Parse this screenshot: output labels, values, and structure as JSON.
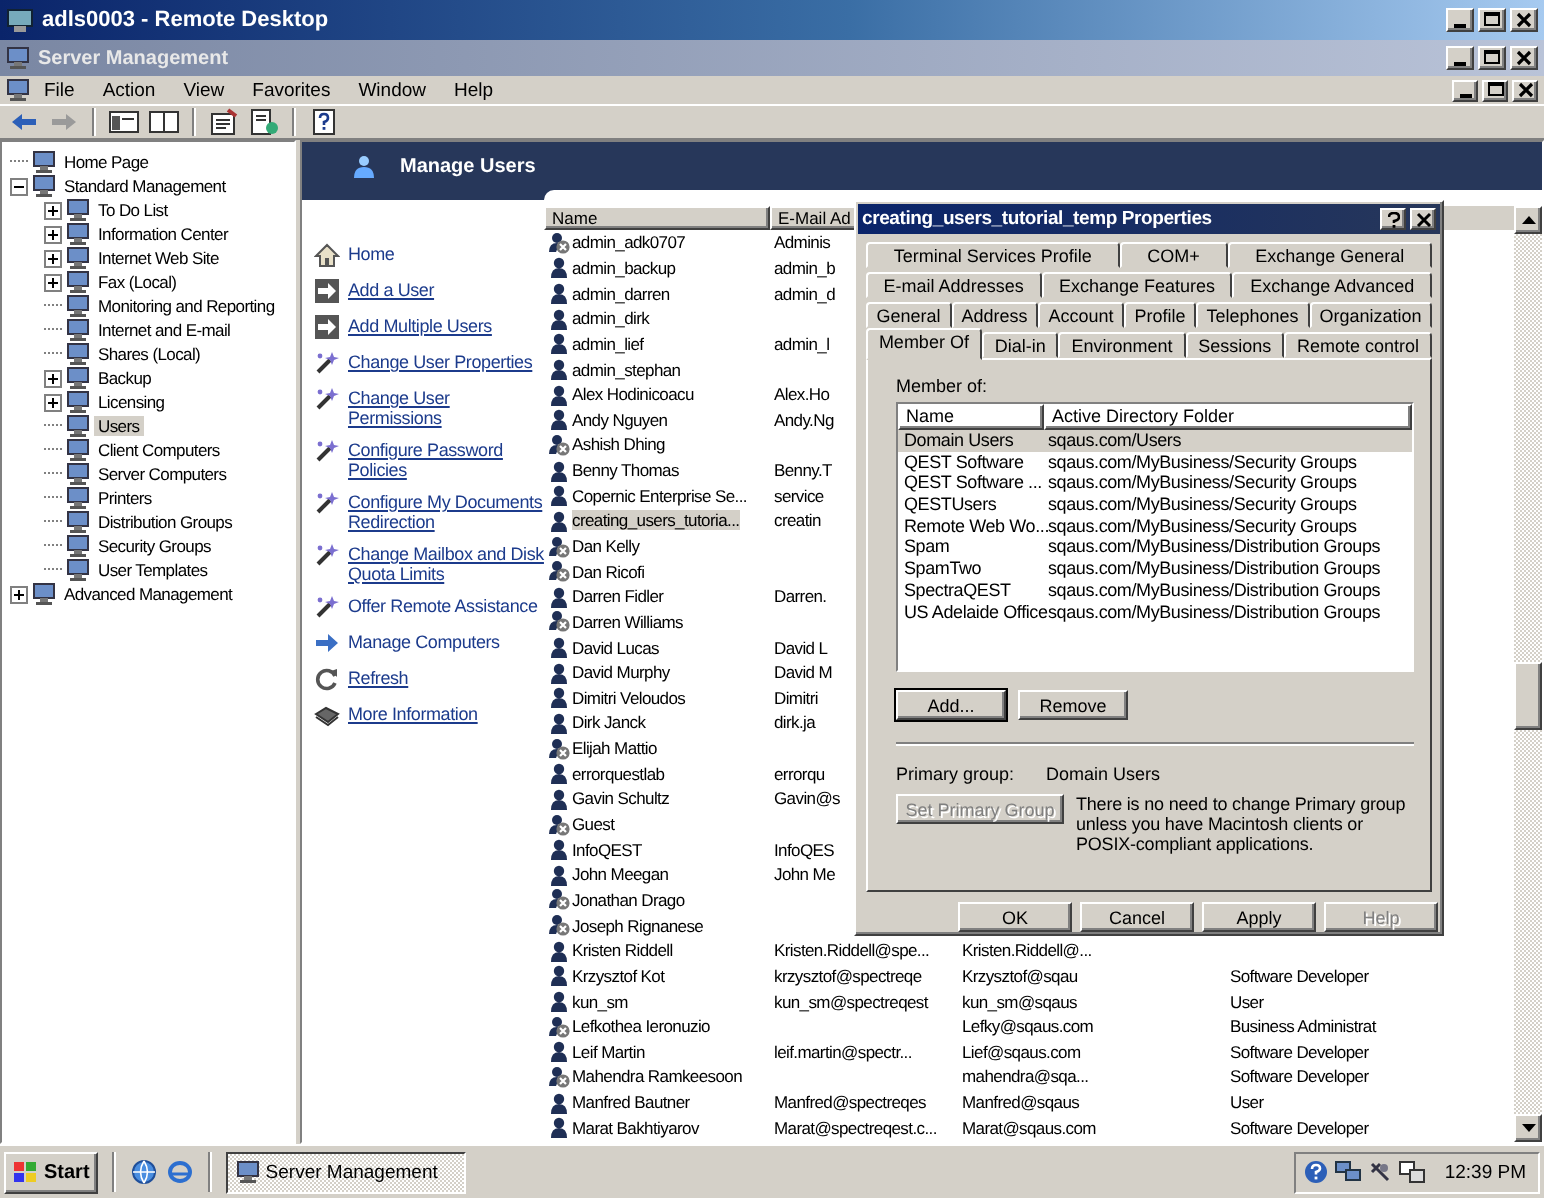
{
  "remote_window": {
    "title": "adls0003 - Remote Desktop"
  },
  "app_window": {
    "title": "Server Management"
  },
  "menu": [
    "File",
    "Action",
    "View",
    "Favorites",
    "Window",
    "Help"
  ],
  "tree": [
    {
      "label": "Home Page",
      "kind": "leaf",
      "expanded": false,
      "selected": false
    },
    {
      "label": "Standard Management",
      "kind": "branch",
      "expanded": true,
      "selected": false,
      "children": [
        {
          "label": "To Do List",
          "kind": "branch",
          "expanded": false,
          "selected": false
        },
        {
          "label": "Information Center",
          "kind": "branch",
          "expanded": false,
          "selected": false
        },
        {
          "label": "Internet Web Site",
          "kind": "branch",
          "expanded": false,
          "selected": false
        },
        {
          "label": "Fax (Local)",
          "kind": "branch",
          "expanded": false,
          "selected": false
        },
        {
          "label": "Monitoring and Reporting",
          "kind": "leaf",
          "expanded": false,
          "selected": false
        },
        {
          "label": "Internet and E-mail",
          "kind": "leaf",
          "expanded": false,
          "selected": false
        },
        {
          "label": "Shares (Local)",
          "kind": "leaf",
          "expanded": false,
          "selected": false
        },
        {
          "label": "Backup",
          "kind": "branch",
          "expanded": false,
          "selected": false
        },
        {
          "label": "Licensing",
          "kind": "branch",
          "expanded": false,
          "selected": false
        },
        {
          "label": "Users",
          "kind": "leaf",
          "expanded": false,
          "selected": true
        },
        {
          "label": "Client Computers",
          "kind": "leaf",
          "expanded": false,
          "selected": false
        },
        {
          "label": "Server Computers",
          "kind": "leaf",
          "expanded": false,
          "selected": false
        },
        {
          "label": "Printers",
          "kind": "leaf",
          "expanded": false,
          "selected": false
        },
        {
          "label": "Distribution Groups",
          "kind": "leaf",
          "expanded": false,
          "selected": false
        },
        {
          "label": "Security Groups",
          "kind": "leaf",
          "expanded": false,
          "selected": false
        },
        {
          "label": "User Templates",
          "kind": "leaf",
          "expanded": false,
          "selected": false
        }
      ]
    },
    {
      "label": "Advanced Management",
      "kind": "branch",
      "expanded": false,
      "selected": false
    }
  ],
  "panel": {
    "title": "Manage Users"
  },
  "tasks": [
    {
      "label": "Home",
      "kind": "home",
      "underlined": false
    },
    {
      "label": "Add a User",
      "kind": "add",
      "underlined": true
    },
    {
      "label": "Add Multiple Users",
      "kind": "add",
      "underlined": true
    },
    {
      "label": "Change User Properties",
      "kind": "wizard",
      "underlined": true
    },
    {
      "label": "Change User Permissions",
      "kind": "wizard",
      "underlined": true
    },
    {
      "label": "Configure Password Policies",
      "kind": "wizard",
      "underlined": true
    },
    {
      "label": "Configure My Documents Redirection",
      "kind": "wizard",
      "underlined": true
    },
    {
      "label": "Change Mailbox and Disk Quota Limits",
      "kind": "wizard",
      "underlined": true
    },
    {
      "label": "Offer Remote Assistance",
      "kind": "wizard",
      "underlined": false
    },
    {
      "label": "Manage Computers",
      "kind": "navigate",
      "underlined": false
    },
    {
      "label": "Refresh",
      "kind": "refresh",
      "underlined": true
    },
    {
      "label": "More Information",
      "kind": "info",
      "underlined": true
    }
  ],
  "user_list": {
    "columns": [
      "Name",
      "E-Mail Ad"
    ],
    "rows": [
      {
        "name": "admin_adk0707",
        "kind": "disabled",
        "selected": false,
        "email": "Adminis"
      },
      {
        "name": "admin_backup",
        "kind": "user",
        "selected": false,
        "email": "admin_b"
      },
      {
        "name": "admin_darren",
        "kind": "user",
        "selected": false,
        "email": "admin_d"
      },
      {
        "name": "admin_dirk",
        "kind": "user",
        "selected": false
      },
      {
        "name": "admin_lief",
        "kind": "user",
        "selected": false,
        "email": "admin_l"
      },
      {
        "name": "admin_stephan",
        "kind": "user",
        "selected": false
      },
      {
        "name": "Alex Hodinicoacu",
        "kind": "user",
        "selected": false,
        "email": "Alex.Ho"
      },
      {
        "name": "Andy Nguyen",
        "kind": "user",
        "selected": false,
        "email": "Andy.Ng"
      },
      {
        "name": "Ashish Dhing",
        "kind": "disabled",
        "selected": false
      },
      {
        "name": "Benny Thomas",
        "kind": "user",
        "selected": false,
        "email": "Benny.T"
      },
      {
        "name": "Copernic Enterprise Se...",
        "kind": "user",
        "selected": false,
        "email": "service"
      },
      {
        "name": "creating_users_tutoria...",
        "kind": "user",
        "selected": true,
        "email": "creatin"
      },
      {
        "name": "Dan Kelly",
        "kind": "disabled",
        "selected": false
      },
      {
        "name": "Dan Ricofi",
        "kind": "disabled",
        "selected": false
      },
      {
        "name": "Darren Fidler",
        "kind": "user",
        "selected": false,
        "email": "Darren."
      },
      {
        "name": "Darren Williams",
        "kind": "disabled",
        "selected": false
      },
      {
        "name": "David Lucas",
        "kind": "user",
        "selected": false,
        "email": "David L"
      },
      {
        "name": "David Murphy",
        "kind": "user",
        "selected": false,
        "email": "David M"
      },
      {
        "name": "Dimitri Veloudos",
        "kind": "user",
        "selected": false,
        "email": "Dimitri"
      },
      {
        "name": "Dirk Janck",
        "kind": "user",
        "selected": false,
        "email": "dirk.ja"
      },
      {
        "name": "Elijah Mattio",
        "kind": "disabled",
        "selected": false
      },
      {
        "name": "errorquestlab",
        "kind": "user",
        "selected": false,
        "email": "errorqu"
      },
      {
        "name": "Gavin Schultz",
        "kind": "user",
        "selected": false,
        "email": "Gavin@s"
      },
      {
        "name": "Guest",
        "kind": "disabled",
        "selected": false
      },
      {
        "name": "InfoQEST",
        "kind": "user",
        "selected": false,
        "email": "InfoQES"
      },
      {
        "name": "John Meegan",
        "kind": "user",
        "selected": false,
        "email": "John Me"
      },
      {
        "name": "Jonathan Drago",
        "kind": "disabled",
        "selected": false
      },
      {
        "name": "Joseph Rignanese",
        "kind": "disabled",
        "selected": false
      },
      {
        "name": "Kristen Riddell",
        "kind": "user",
        "selected": false,
        "email": "Kristen.Riddell@spe...",
        "column_3": "Kristen.Riddell@..."
      },
      {
        "name": "Krzysztof Kot",
        "kind": "user",
        "selected": false,
        "email": "krzysztof@spectreqe",
        "column_3": "Krzysztof@sqau",
        "column_4": "Software Developer"
      },
      {
        "name": "kun_sm",
        "kind": "user",
        "selected": false,
        "email": "kun_sm@spectreqest",
        "column_3": "kun_sm@sqaus",
        "column_4": "User"
      },
      {
        "name": "Lefkothea Ieronuzio",
        "kind": "disabled",
        "selected": false,
        "column_3": "Lefky@sqaus.com",
        "column_4": "Business Administrat"
      },
      {
        "name": "Leif Martin",
        "kind": "user",
        "selected": false,
        "email": "leif.martin@spectr...",
        "column_3": "Lief@sqaus.com",
        "column_4": "Software Developer"
      },
      {
        "name": "Mahendra Ramkeesoon",
        "kind": "disabled",
        "selected": false,
        "column_3": "mahendra@sqa...",
        "column_4": "Software Developer"
      },
      {
        "name": "Manfred Bautner",
        "kind": "user",
        "selected": false,
        "email": "Manfred@spectreqes",
        "column_3": "Manfred@sqaus",
        "column_4": "User"
      },
      {
        "name": "Marat Bakhtiyarov",
        "kind": "user",
        "selected": false,
        "email": "Marat@spectreqest.c...",
        "column_3": "Marat@sqaus.com",
        "column_4": "Software Developer"
      }
    ]
  },
  "dialog": {
    "title": "creating_users_tutorial_temp Properties",
    "tab_rows": [
      [
        {
          "label": "Terminal Services Profile",
          "selected": false
        },
        {
          "label": "COM+",
          "selected": false
        },
        {
          "label": "Exchange General",
          "selected": false
        }
      ],
      [
        {
          "label": "E-mail Addresses",
          "selected": false
        },
        {
          "label": "Exchange Features",
          "selected": false
        },
        {
          "label": "Exchange Advanced",
          "selected": false
        }
      ],
      [
        {
          "label": "General",
          "selected": false
        },
        {
          "label": "Address",
          "selected": false
        },
        {
          "label": "Account",
          "selected": false
        },
        {
          "label": "Profile",
          "selected": false
        },
        {
          "label": "Telephones",
          "selected": false
        },
        {
          "label": "Organization",
          "selected": false
        }
      ],
      [
        {
          "label": "Member Of",
          "selected": true
        },
        {
          "label": "Dial-in",
          "selected": false
        },
        {
          "label": "Environment",
          "selected": false
        },
        {
          "label": "Sessions",
          "selected": false
        },
        {
          "label": "Remote control",
          "selected": false
        }
      ]
    ],
    "member_of_label": "Member of:",
    "member_columns": [
      "Name",
      "Active Directory Folder"
    ],
    "members": [
      {
        "name": "Domain Users",
        "folder": "sqaus.com/Users",
        "selected": true
      },
      {
        "name": "QEST Software",
        "folder": "sqaus.com/MyBusiness/Security Groups",
        "selected": false
      },
      {
        "name": "QEST Software ...",
        "folder": "sqaus.com/MyBusiness/Security Groups",
        "selected": false
      },
      {
        "name": "QESTUsers",
        "folder": "sqaus.com/MyBusiness/Security Groups",
        "selected": false
      },
      {
        "name": "Remote Web Wo...",
        "folder": "sqaus.com/MyBusiness/Security Groups",
        "selected": false
      },
      {
        "name": "Spam",
        "folder": "sqaus.com/MyBusiness/Distribution Groups",
        "selected": false
      },
      {
        "name": "SpamTwo",
        "folder": "sqaus.com/MyBusiness/Distribution Groups",
        "selected": false
      },
      {
        "name": "SpectraQEST",
        "folder": "sqaus.com/MyBusiness/Distribution Groups",
        "selected": false
      },
      {
        "name": "US Adelaide Office",
        "folder": "sqaus.com/MyBusiness/Distribution Groups",
        "selected": false
      }
    ],
    "list_buttons": [
      {
        "label": "Add...",
        "focused": true
      },
      {
        "label": "Remove",
        "focused": false
      }
    ],
    "primary_group_label": "Primary group:",
    "primary_group": "Domain Users",
    "set_primary": {
      "label": "Set Primary Group",
      "disabled": true
    },
    "note": "There is no need to change Primary group unless you have Macintosh clients or POSIX-compliant applications.",
    "buttons": [
      {
        "label": "OK",
        "disabled": false
      },
      {
        "label": "Cancel",
        "disabled": false
      },
      {
        "label": "Apply",
        "disabled": false
      },
      {
        "label": "Help",
        "disabled": true
      }
    ]
  },
  "taskbar": {
    "start": "Start",
    "tasks": [
      {
        "label": "Server Management",
        "selected": true
      }
    ],
    "clock": "12:39 PM"
  }
}
